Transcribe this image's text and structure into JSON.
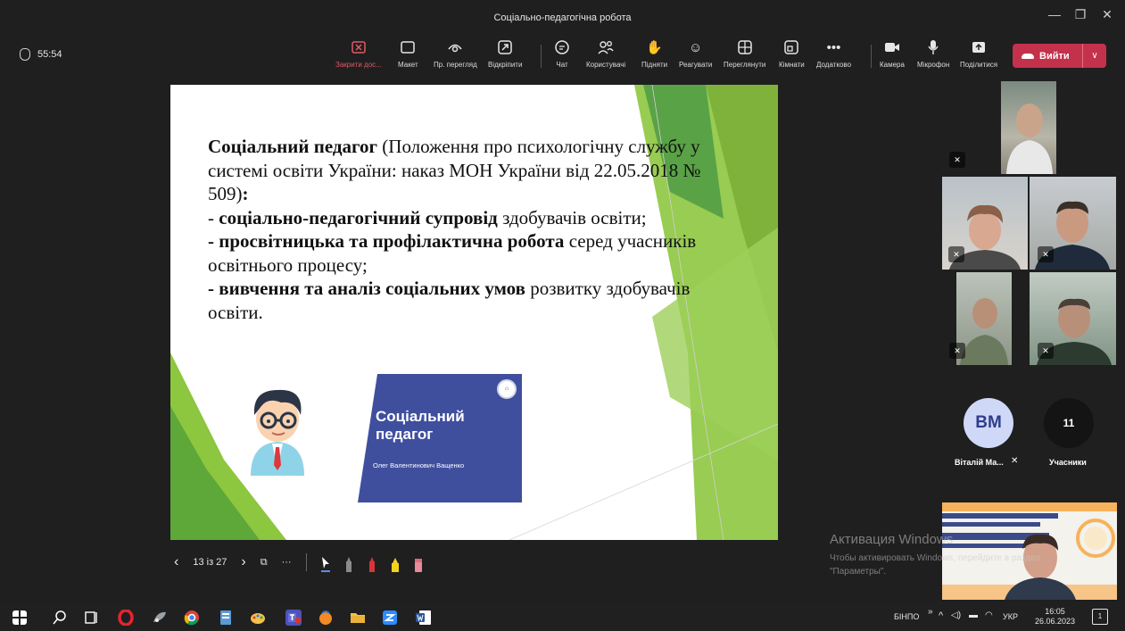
{
  "window": {
    "title": "Соціально-педагогічна робота"
  },
  "toolbar": {
    "timer": "55:54",
    "buttons": [
      {
        "label": "Закрити дос...",
        "icon": "stop-share-icon"
      },
      {
        "label": "Макет",
        "icon": "layout-icon"
      },
      {
        "label": "Пр. перегляд",
        "icon": "eye-icon"
      },
      {
        "label": "Відкріпити",
        "icon": "popout-icon"
      },
      {
        "label": "Чат",
        "icon": "chat-icon"
      },
      {
        "label": "Користувачі",
        "icon": "people-icon"
      },
      {
        "label": "Підняти",
        "icon": "hand-icon"
      },
      {
        "label": "Реагувати",
        "icon": "smile-icon"
      },
      {
        "label": "Переглянути",
        "icon": "grid-icon"
      },
      {
        "label": "Кімнати",
        "icon": "rooms-icon"
      },
      {
        "label": "Додатково",
        "icon": "more-icon"
      },
      {
        "label": "Камера",
        "icon": "camera-icon"
      },
      {
        "label": "Мікрофон",
        "icon": "microphone-icon"
      },
      {
        "label": "Поділитися",
        "icon": "share-icon"
      }
    ],
    "leave_label": "Вийти"
  },
  "slide": {
    "heading_bold": "Соціальний педагог",
    "heading_rest": " (Положення про психологічну службу у системі освіти України: наказ МОН України від 22.05.2018  № 509)",
    "heading_colon": ":",
    "items": [
      {
        "prefix": "- ",
        "bold": "соціально-педагогічний супровід",
        "rest": " здобувачів освіти;"
      },
      {
        "prefix": "- ",
        "bold": "просвітницька та профілактична робота",
        "rest": " серед учасників освітнього процесу;"
      },
      {
        "prefix": "- ",
        "bold": "вивчення та аналіз соціальних умов",
        "rest": " розвитку здобувачів освіти."
      }
    ],
    "card": {
      "title_line1": "Соціальний",
      "title_line2": "педагог",
      "name": "Олег Валентинович Ващенко"
    }
  },
  "slide_controls": {
    "counter": "13 із 27"
  },
  "participants": {
    "initials": "ВМ",
    "initials_name": "Віталій Ма...",
    "count": "11",
    "count_label": "Учасники"
  },
  "watermark": {
    "line1": "Активация Windows",
    "line2": "Чтобы активировать Windows, перейдите в раздел",
    "line3": "\"Параметры\"."
  },
  "taskbar": {
    "lang_label": "БІНПО",
    "keyboard": "УКР",
    "time": "16:05",
    "date": "26.06.2023",
    "notification_count": "1"
  },
  "colors": {
    "leave": "#c4314b",
    "card": "#3f4f9e",
    "slide_green": "#8dc63f"
  }
}
